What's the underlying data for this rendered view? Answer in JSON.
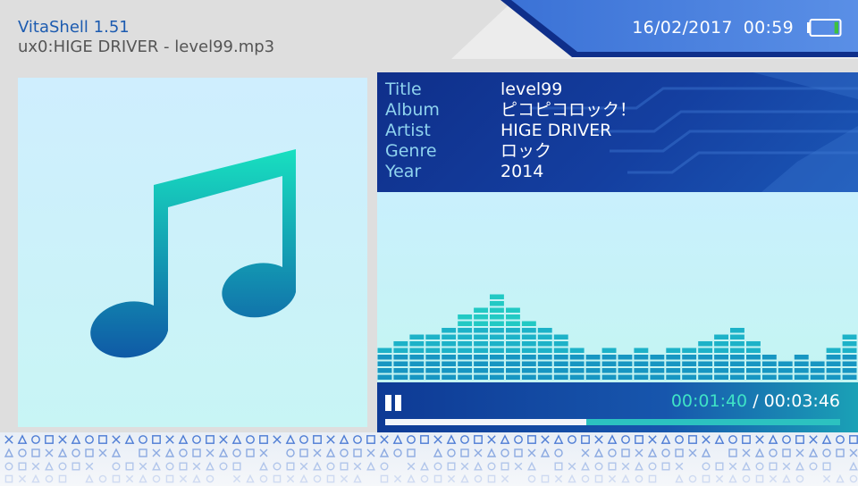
{
  "header": {
    "app_title": "VitaShell 1.51",
    "file_path": "ux0:HIGE DRIVER - level99.mp3",
    "date": "16/02/2017",
    "time": "00:59",
    "battery_icon": "battery-icon",
    "battery_level": 0.15
  },
  "album_art": {
    "icon": "music-note-icon"
  },
  "track_info": {
    "rows": [
      {
        "label": "Title",
        "value": "level99"
      },
      {
        "label": "Album",
        "value": "ピコピコロック！"
      },
      {
        "label": "Artist",
        "value": "HIGE DRIVER"
      },
      {
        "label": "Genre",
        "value": "ロック"
      },
      {
        "label": "Year",
        "value": "2014"
      }
    ]
  },
  "visualizer": {
    "levels": [
      5,
      6,
      7,
      7,
      8,
      10,
      11,
      13,
      11,
      9,
      8,
      7,
      5,
      4,
      5,
      4,
      5,
      4,
      5,
      5,
      6,
      7,
      8,
      6,
      4,
      3,
      4,
      3,
      5,
      7
    ]
  },
  "player": {
    "state": "paused",
    "pause_icon": "pause-icon",
    "current_time": "00:01:40",
    "separator": "/",
    "total_time": "00:03:46",
    "progress": 0.4425
  },
  "colors": {
    "accent_blue": "#1c5bb0",
    "teal": "#2cc2c0",
    "panel_dark": "#0f2f8a",
    "label_cyan": "#8fd3ee",
    "bar_color": "#1aa0c8"
  }
}
